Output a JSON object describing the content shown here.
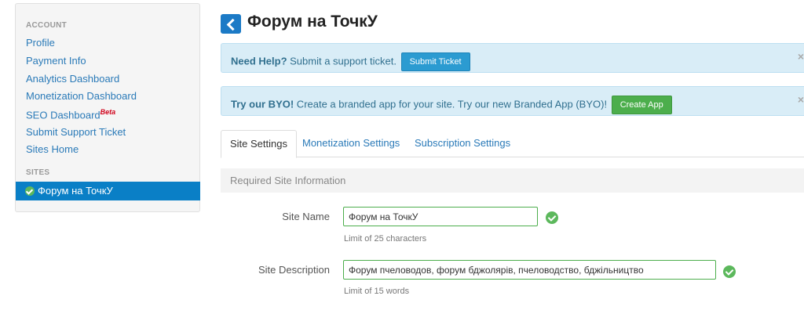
{
  "sidebar": {
    "account_heading": "ACCOUNT",
    "items": [
      {
        "label": "Profile"
      },
      {
        "label": "Payment Info"
      },
      {
        "label": "Analytics Dashboard"
      },
      {
        "label": "Monetization Dashboard"
      },
      {
        "label": "SEO Dashboard",
        "badge": "Beta"
      },
      {
        "label": "Submit Support Ticket"
      },
      {
        "label": "Sites Home"
      }
    ],
    "sites_heading": "SITES",
    "active_site": "Форум на ТочкУ"
  },
  "header": {
    "title": "Форум на ТочкУ"
  },
  "alerts": {
    "help": {
      "strong": "Need Help?",
      "text": " Submit a support ticket.",
      "button": "Submit Ticket",
      "close": "×"
    },
    "byo": {
      "strong": "Try our BYO!",
      "text": " Create a branded app for your site. Try our new Branded App (BYO)!",
      "button": "Create App",
      "close": "×"
    }
  },
  "tabs": [
    {
      "label": "Site Settings",
      "active": true
    },
    {
      "label": "Monetization Settings",
      "active": false
    },
    {
      "label": "Subscription Settings",
      "active": false
    }
  ],
  "form": {
    "section_title": "Required Site Information",
    "site_name": {
      "label": "Site Name",
      "value": "Форум на ТочкУ",
      "help": "Limit of 25 characters"
    },
    "site_description": {
      "label": "Site Description",
      "value": "Форум пчеловодов, форум бджолярів, пчеловодство, бджільництво",
      "help": "Limit of 15 words"
    }
  },
  "colors": {
    "primary_blue": "#0a7fc6",
    "link_blue": "#2a7ab8",
    "alert_bg": "#d9edf7",
    "success_green": "#5cb85c"
  }
}
